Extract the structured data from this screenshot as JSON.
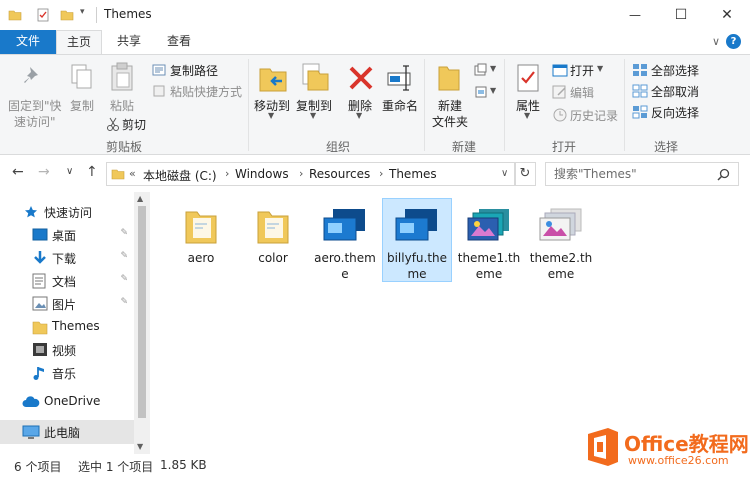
{
  "window": {
    "title": "Themes",
    "minimize_glyph": "—",
    "maximize_glyph": "☐",
    "close_glyph": "✕"
  },
  "tabs": {
    "file": "文件",
    "home": "主页",
    "share": "共享",
    "view": "查看",
    "expand_glyph": "∨",
    "help_glyph": "?"
  },
  "ribbon": {
    "clipboard": {
      "group_label": "剪贴板",
      "pin_line1": "固定到\"快",
      "pin_line2": "速访问\"",
      "copy": "复制",
      "paste": "粘贴",
      "copy_path": "复制路径",
      "paste_shortcut": "粘贴快捷方式",
      "cut": "剪切"
    },
    "organize": {
      "group_label": "组织",
      "move_to": "移动到",
      "copy_to": "复制到",
      "delete": "删除",
      "rename": "重命名"
    },
    "new": {
      "group_label": "新建",
      "new_folder_line1": "新建",
      "new_folder_line2": "文件夹"
    },
    "open": {
      "group_label": "打开",
      "properties": "属性",
      "open": "打开",
      "edit": "编辑",
      "history": "历史记录"
    },
    "select": {
      "group_label": "选择",
      "select_all": "全部选择",
      "select_none": "全部取消",
      "invert": "反向选择"
    }
  },
  "address": {
    "overflow": "«",
    "crumbs": [
      "本地磁盘 (C:)",
      "Windows",
      "Resources",
      "Themes"
    ],
    "separator": "›",
    "dropdown_glyph": "∨",
    "refresh_glyph": "↻",
    "search_placeholder": "搜索\"Themes\"",
    "back_glyph": "←",
    "forward_glyph": "→",
    "recent_glyph": "∨",
    "up_glyph": "↑"
  },
  "nav": {
    "quick_access": "快速访问",
    "desktop": "桌面",
    "downloads": "下载",
    "documents": "文档",
    "pictures": "图片",
    "themes": "Themes",
    "videos": "视频",
    "music": "音乐",
    "onedrive": "OneDrive",
    "this_pc": "此电脑",
    "pin_glyph": "📌"
  },
  "files": [
    {
      "name": "aero",
      "type": "folder"
    },
    {
      "name": "color",
      "type": "folder"
    },
    {
      "name": "aero.theme",
      "type": "theme-blue"
    },
    {
      "name": "billyfu.theme",
      "type": "theme-blue",
      "selected": true
    },
    {
      "name": "theme1.theme",
      "type": "theme-colorful"
    },
    {
      "name": "theme2.theme",
      "type": "theme-colorful"
    }
  ],
  "status": {
    "item_count": "6 个项目",
    "selected": "选中 1 个项目",
    "size": "1.85 KB"
  },
  "watermark": {
    "brand": "Office教程网",
    "url": "www.office26.com"
  },
  "colors": {
    "accent": "#1979ca",
    "selection_fill": "#cce8ff",
    "selection_border": "#99d1ff",
    "folder": "#f0c85a",
    "delete_red": "#d9342b",
    "watermark_orange": "#f26b1d"
  }
}
